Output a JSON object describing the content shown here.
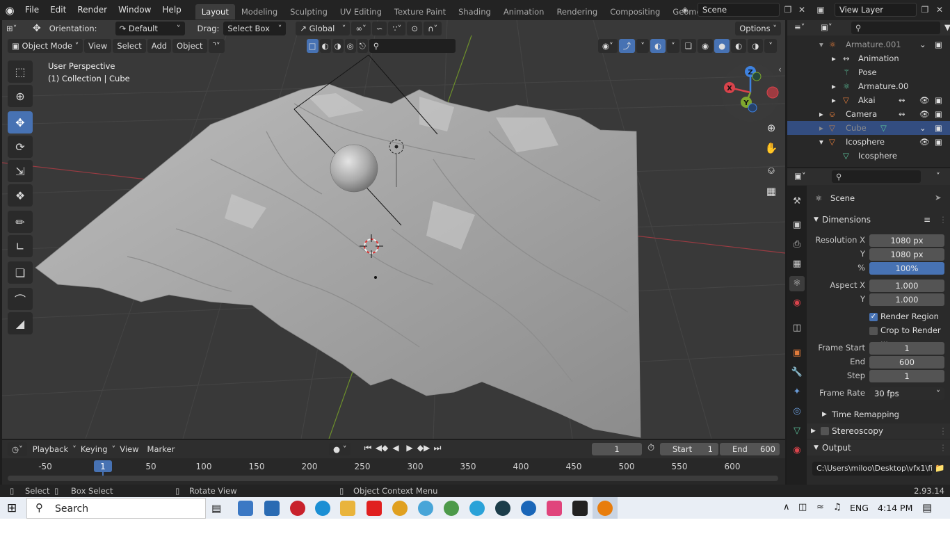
{
  "topbar": {
    "menus": [
      "File",
      "Edit",
      "Render",
      "Window",
      "Help"
    ],
    "workspaces": [
      "Layout",
      "Modeling",
      "Sculpting",
      "UV Editing",
      "Texture Paint",
      "Shading",
      "Animation",
      "Rendering",
      "Compositing",
      "Geometry Nod"
    ],
    "active_workspace": "Layout",
    "scene": "Scene",
    "view_layer": "View Layer"
  },
  "tool_header": {
    "orientation_label": "Orientation:",
    "orientation_value": "Default",
    "drag_label": "Drag:",
    "drag_value": "Select Box",
    "transform_space": "Global",
    "options": "Options"
  },
  "viewport_header": {
    "mode": "Object Mode",
    "menus": [
      "View",
      "Select",
      "Add",
      "Object"
    ]
  },
  "viewport": {
    "perspective": "User Perspective",
    "collection_info": "(1) Collection | Cube",
    "gizmo_axes": [
      "X",
      "Y",
      "Z"
    ]
  },
  "timeline": {
    "menus": [
      "Playback",
      "Keying",
      "View",
      "Marker"
    ],
    "current_frame": "1",
    "start_label": "Start",
    "start_value": "1",
    "end_label": "End",
    "end_value": "600",
    "ruler": [
      "-50",
      "1",
      "50",
      "100",
      "150",
      "200",
      "250",
      "300",
      "350",
      "400",
      "450",
      "500",
      "550",
      "600"
    ]
  },
  "statusbar": {
    "select": "Select",
    "box_select": "Box Select",
    "rotate_view": "Rotate View",
    "context_menu": "Object Context Menu",
    "version": "2.93.14"
  },
  "outliner": {
    "rows": [
      {
        "label": "Armature.001",
        "icon": "armature-icon",
        "selected": false,
        "muted": true
      },
      {
        "label": "Animation",
        "icon": "action-icon",
        "selected": false,
        "muted": false
      },
      {
        "label": "Pose",
        "icon": "pose-icon",
        "selected": false,
        "muted": false
      },
      {
        "label": "Armature.00",
        "icon": "armature-data-icon",
        "selected": false,
        "muted": false
      },
      {
        "label": "Akai",
        "icon": "mesh-icon",
        "selected": false,
        "muted": false
      },
      {
        "label": "Camera",
        "icon": "camera-icon",
        "selected": false,
        "muted": false
      },
      {
        "label": "Cube",
        "icon": "mesh-icon",
        "selected": true,
        "muted": true
      },
      {
        "label": "Icosphere",
        "icon": "mesh-icon",
        "selected": false,
        "muted": false
      },
      {
        "label": "Icosphere",
        "icon": "mesh-data-icon",
        "selected": false,
        "muted": false
      }
    ]
  },
  "properties": {
    "context": "Scene",
    "dimensions_title": "Dimensions",
    "resolution_x_label": "Resolution X",
    "resolution_x": "1080 px",
    "resolution_y_label": "Y",
    "resolution_y": "1080 px",
    "percent_label": "%",
    "percent": "100%",
    "aspect_x_label": "Aspect X",
    "aspect_x": "1.000",
    "aspect_y_label": "Y",
    "aspect_y": "1.000",
    "render_region": "Render Region",
    "crop_to_render": "Crop to Render ...",
    "frame_start_label": "Frame Start",
    "frame_start": "1",
    "end_label": "End",
    "end": "600",
    "step_label": "Step",
    "step": "1",
    "frame_rate_label": "Frame Rate",
    "frame_rate": "30 fps",
    "time_remapping": "Time Remapping",
    "stereoscopy": "Stereoscopy",
    "output_title": "Output",
    "output_path": "C:\\Users\\miloo\\Desktop\\vfx1\\fi..."
  },
  "taskbar": {
    "search": "Search",
    "language": "ENG",
    "time": "4:14 PM"
  },
  "colors": {
    "accent": "#4772b3",
    "selection": "#334d80",
    "axis_x": "#d9434b",
    "axis_y": "#7ea72e",
    "axis_z": "#3e82e0"
  }
}
